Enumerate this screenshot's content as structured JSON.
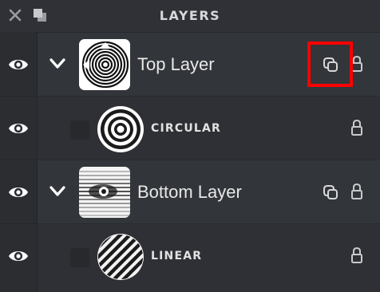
{
  "panel": {
    "title": "LAYERS",
    "close_icon": "close-icon",
    "collapse_icon": "panel-collapse-icon"
  },
  "layers": [
    {
      "name": "Top Layer",
      "type": "layer",
      "expanded": true,
      "visible": true,
      "linked": true,
      "locked": false,
      "thumbnail": "spiral-pattern"
    },
    {
      "name": "CIRCULAR",
      "type": "mask",
      "visible": true,
      "locked": false,
      "thumbnail": "concentric-circles"
    },
    {
      "name": "Bottom Layer",
      "type": "layer",
      "expanded": true,
      "visible": true,
      "linked": true,
      "locked": false,
      "thumbnail": "halftone-eye"
    },
    {
      "name": "LINEAR",
      "type": "mask",
      "visible": true,
      "locked": false,
      "thumbnail": "diagonal-stripes"
    }
  ],
  "colors": {
    "highlight": "#ff0000",
    "background": "#2b2d31",
    "row": "#32353a"
  }
}
